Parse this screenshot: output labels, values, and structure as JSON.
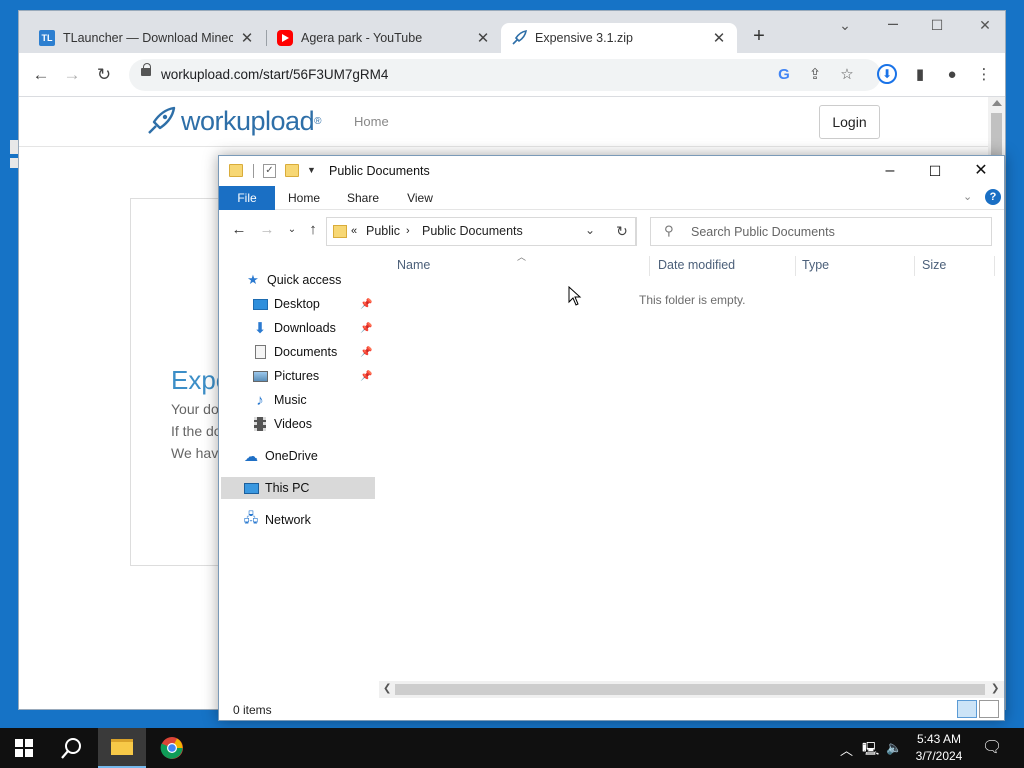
{
  "browser": {
    "tabs": [
      {
        "title": "TLauncher — Download Minecra",
        "favicon": "TL"
      },
      {
        "title": "Agera park - YouTube",
        "favicon": "youtube-icon"
      },
      {
        "title": "Expensive 3.1.zip",
        "favicon": "workupload-icon"
      }
    ],
    "url": "workupload.com/start/56F3UM7gRM4"
  },
  "site": {
    "logo_text": "workupload",
    "logo_reg": "®",
    "nav_home": "Home",
    "login_label": "Login",
    "card_title": "Expe",
    "card_lines": [
      "Your do",
      "If the do",
      "We have"
    ]
  },
  "explorer": {
    "title": "Public Documents",
    "ribbon_tabs": [
      "File",
      "Home",
      "Share",
      "View"
    ],
    "breadcrumb": [
      "Public",
      "Public Documents"
    ],
    "breadcrumb_overflow": "«",
    "search_placeholder": "Search Public Documents",
    "nav": {
      "quick_access": "Quick access",
      "desktop": "Desktop",
      "downloads": "Downloads",
      "documents": "Documents",
      "pictures": "Pictures",
      "music": "Music",
      "videos": "Videos",
      "onedrive": "OneDrive",
      "this_pc": "This PC",
      "network": "Network"
    },
    "columns": [
      "Name",
      "Date modified",
      "Type",
      "Size"
    ],
    "empty_message": "This folder is empty.",
    "status": "0 items"
  },
  "taskbar": {
    "time": "5:43 AM",
    "date": "3/7/2024"
  },
  "colors": {
    "desktop": "#1673c6",
    "explorer_accent": "#1a6fc4",
    "workupload_blue": "#2e6fa8"
  }
}
